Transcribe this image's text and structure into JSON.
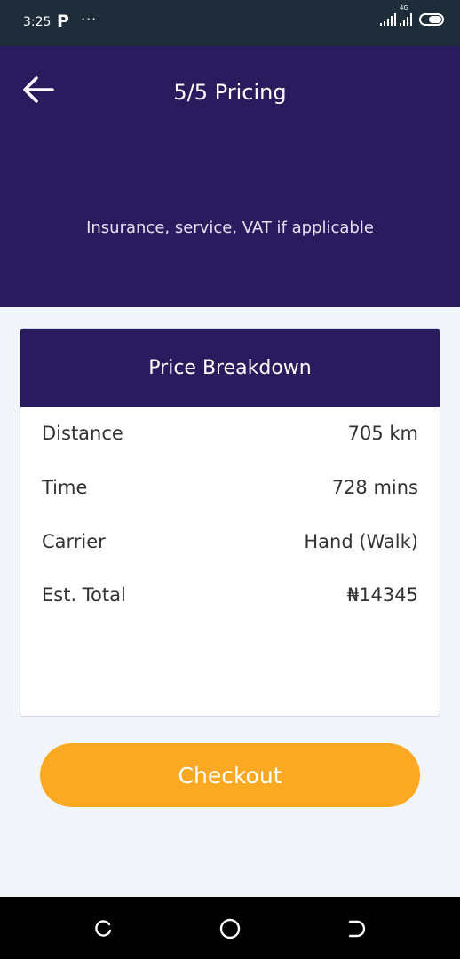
{
  "status_bar": {
    "time": "3:25",
    "app_badge": "P",
    "more": "···",
    "network": "4G"
  },
  "header": {
    "title": "5/5 Pricing",
    "subtitle": "Insurance, service, VAT if applicable"
  },
  "breakdown": {
    "title": "Price Breakdown",
    "rows": [
      {
        "label": "Distance",
        "value": "705 km"
      },
      {
        "label": "Time",
        "value": "728 mins"
      },
      {
        "label": "Carrier",
        "value": "Hand (Walk)"
      },
      {
        "label": "Est. Total",
        "value": "₦14345"
      }
    ]
  },
  "checkout_label": "Checkout",
  "colors": {
    "primary": "#2a1b5e",
    "accent": "#fba922",
    "background": "#f1f4f8"
  },
  "icons": [
    "back-arrow-icon",
    "signal-icon",
    "battery-icon",
    "recent-apps-icon",
    "home-icon",
    "back-nav-icon"
  ]
}
